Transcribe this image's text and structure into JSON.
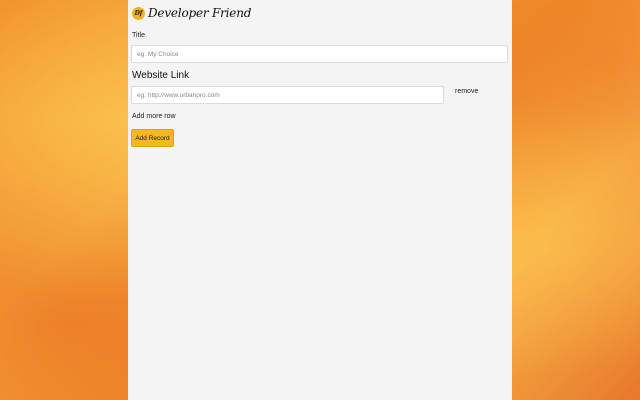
{
  "brand": {
    "logo_text": "Df",
    "name": "Developer Friend"
  },
  "form": {
    "title_label": "Title",
    "title_placeholder": "eg: My Choice",
    "title_value": "",
    "section_title": "Website Link",
    "link_placeholder": "eg: http://www.urbanpro.com",
    "link_value": "",
    "remove_label": "remove",
    "add_row_label": "Add more row",
    "submit_label": "Add Record"
  },
  "colors": {
    "accent": "#f3b824",
    "panel_bg": "#f4f4f4",
    "background": "#f08a2a"
  }
}
